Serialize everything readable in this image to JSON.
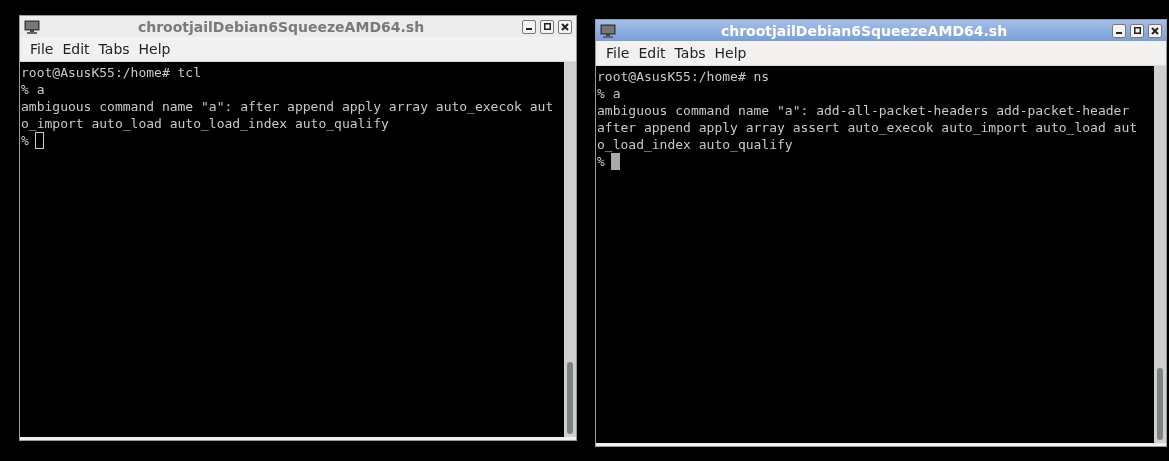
{
  "windows": [
    {
      "title": "chrootjailDebian6SqueezeAMD64.sh",
      "active": false,
      "menu": [
        "File",
        "Edit",
        "Tabs",
        "Help"
      ],
      "lines": [
        "root@AsusK55:/home# tcl",
        "% a",
        "ambiguous command name \"a\": after append apply array auto_execok aut",
        "o_import auto_load auto_load_index auto_qualify",
        "%"
      ]
    },
    {
      "title": "chrootjailDebian6SqueezeAMD64.sh",
      "active": true,
      "menu": [
        "File",
        "Edit",
        "Tabs",
        "Help"
      ],
      "lines": [
        "root@AsusK55:/home# ns",
        "% a",
        "ambiguous command name \"a\": add-all-packet-headers add-packet-header",
        "after append apply array assert auto_execok auto_import auto_load aut",
        "o_load_index auto_qualify",
        "%"
      ]
    }
  ]
}
